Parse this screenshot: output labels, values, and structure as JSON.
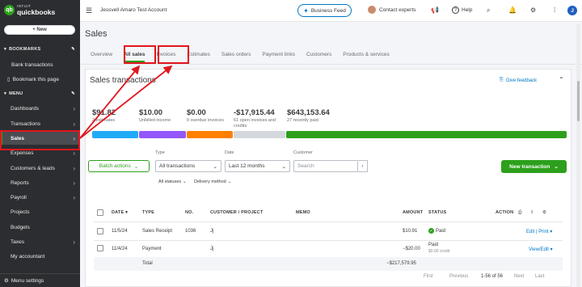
{
  "brand": {
    "top": "INTUIT",
    "bottom": "quickbooks"
  },
  "sidebar": {
    "new_label": "+ New",
    "bookmarks_title": "BOOKMARKS",
    "bank_transactions": "Bank transactions",
    "bookmark_page": "Bookmark this page",
    "menu_title": "MENU",
    "items": [
      {
        "label": "Dashboards"
      },
      {
        "label": "Transactions"
      },
      {
        "label": "Sales"
      },
      {
        "label": "Expenses"
      },
      {
        "label": "Customers & leads"
      },
      {
        "label": "Reports"
      },
      {
        "label": "Payroll"
      },
      {
        "label": "Projects"
      },
      {
        "label": "Budgets"
      },
      {
        "label": "Taxes"
      },
      {
        "label": "My accountant"
      }
    ],
    "menu_settings": "Menu settings"
  },
  "header": {
    "company": "Jessvell Amaro Test Account",
    "business_feed": "Business Feed",
    "contact_experts": "Contact experts",
    "help": "Help",
    "user_initial": "J"
  },
  "page": {
    "title": "Sales",
    "tabs": [
      "Overview",
      "All sales",
      "Invoices",
      "Estimates",
      "Sales orders",
      "Payment links",
      "Customers",
      "Products & services"
    ]
  },
  "card": {
    "title": "Sales transactions",
    "feedback": "Give feedback"
  },
  "money_bar": [
    {
      "amount": "$91.82",
      "desc": "2 estimates",
      "color": "#21abf6"
    },
    {
      "amount": "$10.00",
      "desc": "Unbilled income",
      "color": "#9457fa"
    },
    {
      "amount": "$0.00",
      "desc": "0 overdue invoices",
      "color": "#ff8000"
    },
    {
      "amount": "-$17,915.44",
      "desc": "61 open invoices and credits",
      "color": "#d4d7dc"
    },
    {
      "amount": "$643,153.64",
      "desc": "27 recently paid",
      "color": "#2ca01c"
    }
  ],
  "filters": {
    "batch_actions": "Batch actions",
    "type_label": "Type",
    "type_value": "All transactions",
    "date_label": "Date",
    "date_value": "Last 12 months",
    "customer_label": "Customer",
    "search_placeholder": "Search",
    "new_transaction": "New transaction",
    "all_statuses": "All statuses",
    "delivery_method": "Delivery method"
  },
  "table": {
    "headers": {
      "date": "DATE",
      "type": "TYPE",
      "no": "NO.",
      "customer": "CUSTOMER / PROJECT",
      "memo": "MEMO",
      "amount": "AMOUNT",
      "status": "STATUS",
      "action": "ACTION"
    },
    "rows": [
      {
        "date": "11/5/24",
        "type": "Sales Receipt",
        "no": "1036",
        "customer": "Jj",
        "amount": "$10.91",
        "status": "Paid",
        "status_sub": "",
        "action": "Edit | Print"
      },
      {
        "date": "11/4/24",
        "type": "Payment",
        "no": "",
        "customer": "Jj",
        "amount": "−$20.00",
        "status": "Paid",
        "status_sub": "$0.00 credit",
        "action": "View/Edit"
      }
    ],
    "total_label": "Total",
    "total_amount": "−$217,579.95"
  },
  "pager": {
    "first": "First",
    "previous": "Previous",
    "range": "1-56 of 56",
    "next": "Next",
    "last": "Last"
  }
}
